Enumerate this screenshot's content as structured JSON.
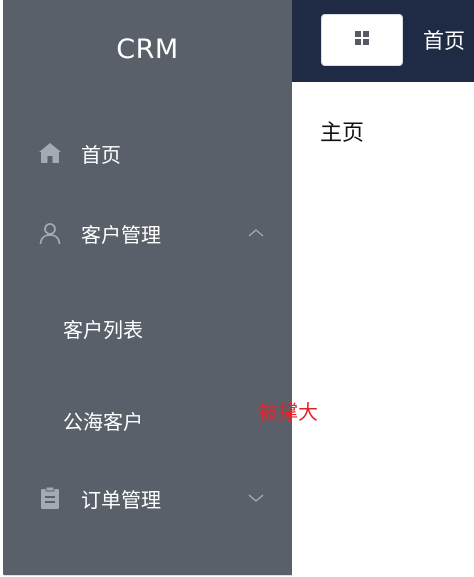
{
  "sidebar": {
    "brand": "CRM",
    "items": [
      {
        "label": "首页",
        "icon": "home-icon"
      },
      {
        "label": "客户管理",
        "icon": "user-icon",
        "expanded": true,
        "children": [
          {
            "label": "客户列表"
          },
          {
            "label": "公海客户"
          }
        ]
      },
      {
        "label": "订单管理",
        "icon": "clipboard-icon",
        "expanded": false
      }
    ]
  },
  "header": {
    "grid_button_icon": "grid-icon",
    "title": "首页"
  },
  "main": {
    "page_title": "主页",
    "overlay_text": "被撑大"
  },
  "colors": {
    "sidebar_bg": "#59606a",
    "header_bg": "#1f2a44",
    "overlay_text": "#e3232b"
  }
}
